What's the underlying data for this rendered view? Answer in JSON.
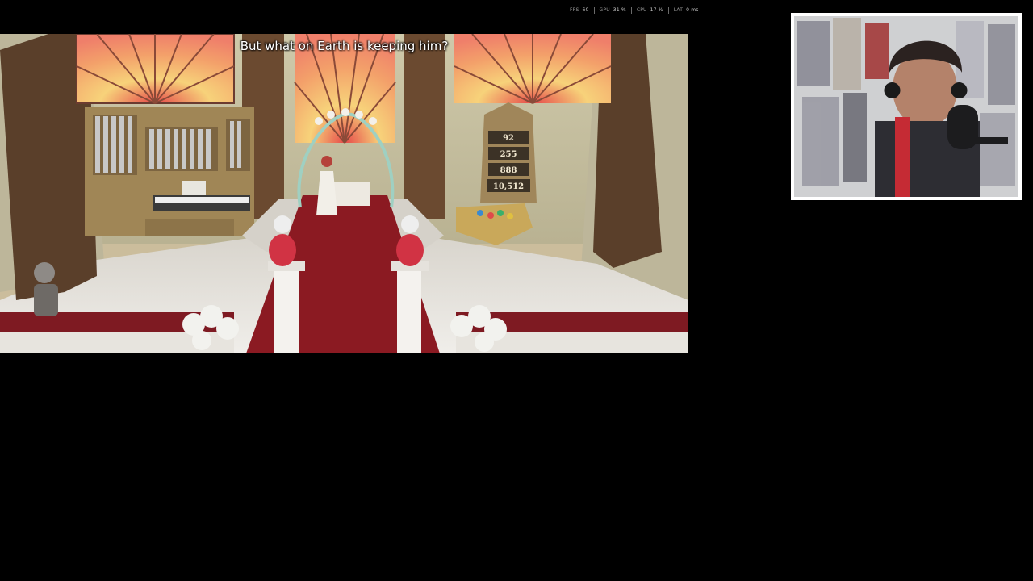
{
  "overlay": {
    "fps_label": "FPS",
    "fps_value": "60",
    "gpu_label": "GPU",
    "gpu_value": "31 %",
    "cpu_label": "CPU",
    "cpu_value": "17 %",
    "lat_label": "LAT",
    "lat_value": "0 ms"
  },
  "game": {
    "subtitle": "But what on Earth is keeping him?",
    "hymn_board": [
      "92",
      "255",
      "888",
      "10,512"
    ]
  },
  "webcam": {
    "icon": "streamer-webcam-feed"
  },
  "colors": {
    "background": "#000000",
    "carpet": "#8b1a22",
    "stained_glass": "#f08a6a",
    "wall": "#c9c3a4"
  }
}
